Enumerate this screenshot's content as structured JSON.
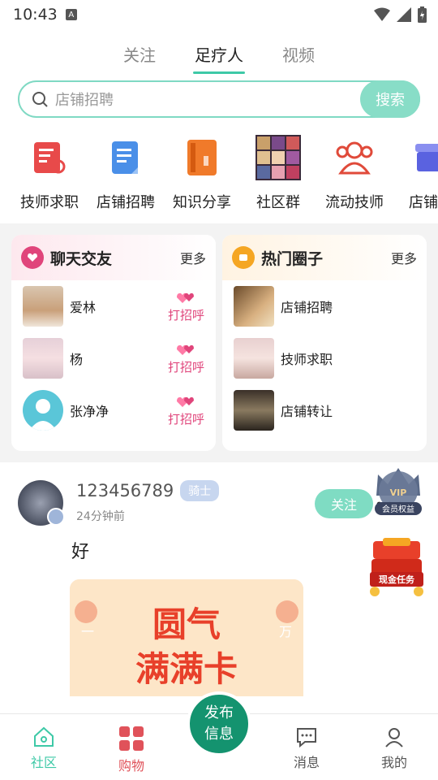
{
  "status_bar": {
    "time": "10:43",
    "a_icon": "A"
  },
  "top_tabs": [
    "关注",
    "足疗人",
    "视频"
  ],
  "search": {
    "placeholder": "店铺招聘",
    "button": "搜索"
  },
  "categories": [
    {
      "label": "技师求职",
      "icon": "resume-icon"
    },
    {
      "label": "店铺招聘",
      "icon": "document-icon"
    },
    {
      "label": "知识分享",
      "icon": "book-icon"
    },
    {
      "label": "社区群",
      "icon": "group-photo-icon"
    },
    {
      "label": "流动技师",
      "icon": "people-icon"
    },
    {
      "label": "店铺转",
      "icon": "shop-icon"
    }
  ],
  "chat_card": {
    "title": "聊天交友",
    "more": "更多",
    "items": [
      {
        "name": "爱林",
        "action": "打招呼"
      },
      {
        "name": "杨",
        "action": "打招呼"
      },
      {
        "name": "张净净",
        "action": "打招呼"
      }
    ]
  },
  "circle_card": {
    "title": "热门圈子",
    "more": "更多",
    "items": [
      {
        "name": "店铺招聘"
      },
      {
        "name": "技师求职"
      },
      {
        "name": "店铺转让"
      }
    ]
  },
  "post": {
    "username": "123456789",
    "level": "骑士",
    "time": "24分钟前",
    "follow": "关注",
    "more": "•••",
    "content": "好",
    "promo_text": "圆气满满卡",
    "promo_left": "一口甜糯",
    "promo_right": "万事圆满"
  },
  "floating": {
    "vip": "会员权益",
    "vip_tag": "VIP",
    "task": "现金任务"
  },
  "bottom_nav": {
    "community": "社区",
    "shop": "购物",
    "publish_line1": "发布",
    "publish_line2": "信息",
    "messages": "消息",
    "me": "我的"
  },
  "colors": {
    "accent": "#3ec9a7",
    "pink": "#e0457b",
    "publish": "#14936f"
  }
}
